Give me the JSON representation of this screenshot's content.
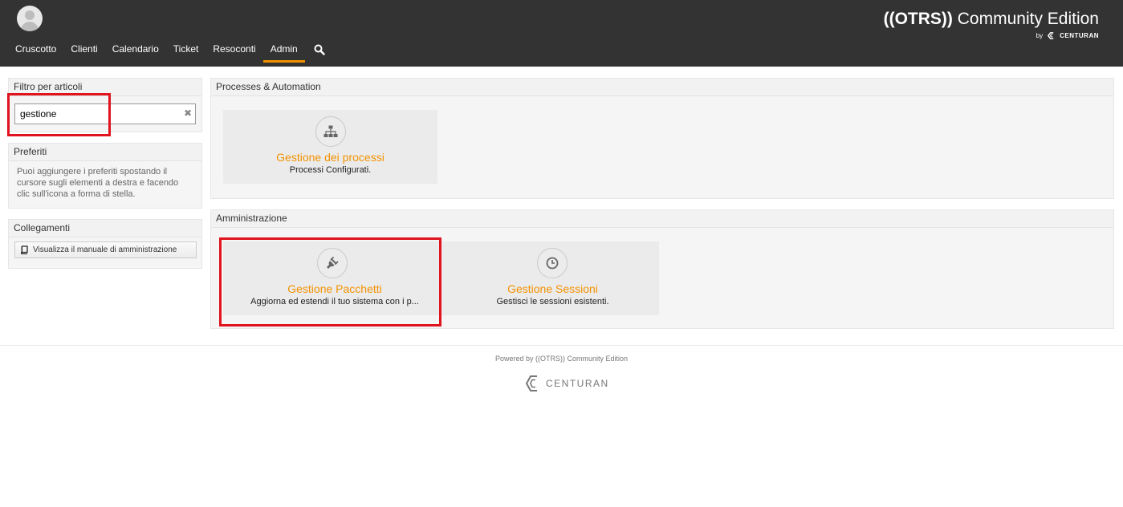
{
  "header": {
    "brand_prefix": "((OTRS))",
    "brand_suffix": " Community Edition",
    "brand_by": "by",
    "brand_vendor": "CENTURAN",
    "nav": [
      {
        "label": "Cruscotto"
      },
      {
        "label": "Clienti"
      },
      {
        "label": "Calendario"
      },
      {
        "label": "Ticket"
      },
      {
        "label": "Resoconti"
      },
      {
        "label": "Admin",
        "active": true
      }
    ],
    "search_icon": "search-icon"
  },
  "sidebar": {
    "filter": {
      "title": "Filtro per articoli",
      "value": "gestione",
      "clear_icon": "close-icon"
    },
    "favorites": {
      "title": "Preferiti",
      "text": "Puoi aggiungere i preferiti spostando il cursore sugli elementi a destra e facendo clic sull'icona a forma di stella."
    },
    "links": {
      "title": "Collegamenti",
      "button": "Visualizza il manuale di amministrazione",
      "button_icon": "book-icon"
    }
  },
  "main": {
    "processes": {
      "title": "Processes & Automation",
      "tiles": [
        {
          "title": "Gestione dei processi",
          "desc": "Processi Configurati.",
          "icon": "sitemap-icon"
        }
      ]
    },
    "admin": {
      "title": "Amministrazione",
      "tiles": [
        {
          "title": "Gestione Pacchetti",
          "desc": "Aggiorna ed estendi il tuo sistema con i p...",
          "icon": "plug-icon"
        },
        {
          "title": "Gestione Sessioni",
          "desc": "Gestisci le sessioni esistenti.",
          "icon": "clock-icon"
        }
      ]
    }
  },
  "footer": {
    "powered": "Powered by ((OTRS)) Community Edition",
    "vendor": "CENTURAN"
  },
  "colors": {
    "accent": "#f39200",
    "header_bg": "#333333",
    "highlight": "#e0141e"
  }
}
